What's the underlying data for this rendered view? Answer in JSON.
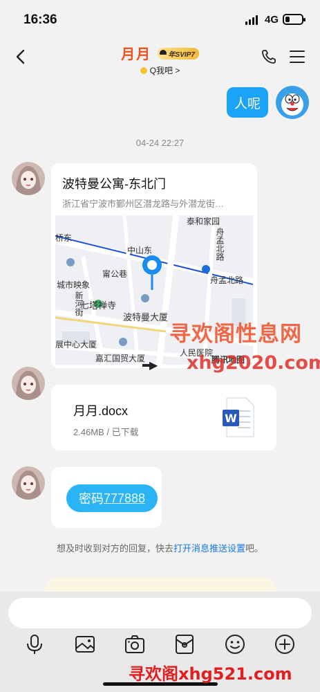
{
  "status_bar": {
    "time": "16:36",
    "network": "4G",
    "battery_percent": 25
  },
  "header": {
    "contact_name": "月月",
    "vip_badge": "年SVIP7",
    "subtitle": "Q我吧 >"
  },
  "messages": {
    "outgoing_text": "人呢",
    "timestamp": "04-24 22:27",
    "location": {
      "title": "波特曼公寓-东北门",
      "address": "浙江省宁波市鄞州区潜龙路与外潜龙街…",
      "map_labels": [
        "泰和家园",
        "舟孟北路",
        "桥东",
        "中山东",
        "甯公巷",
        "城市映象",
        "舟孟北路",
        "新河街",
        "七塔禅寺",
        "波特曼大厦",
        "展中心大厦",
        "嘉汇国贸大厦",
        "人民医院",
        "腾讯地图"
      ]
    },
    "file": {
      "name": "月月.docx",
      "meta": "2.46MB / 已下载"
    },
    "password": {
      "label": "密码",
      "value": "777888"
    }
  },
  "notice": {
    "prefix": "想及时收到对方的回复，快去",
    "link": "打开消息推送设置",
    "suffix": "吧。"
  },
  "input": {
    "placeholder": ""
  },
  "toolbar": [
    "mic-icon",
    "image-icon",
    "camera-icon",
    "red-packet-icon",
    "emoji-icon",
    "plus-icon"
  ],
  "watermarks": {
    "top": "寻欢阁性息网",
    "middle": "xhg2020.com",
    "bottom": "寻欢阁xhg521.com"
  },
  "colors": {
    "accent_blue": "#1aa3f8",
    "title_orange": "#f04e1a",
    "link_blue": "#1677e6"
  }
}
